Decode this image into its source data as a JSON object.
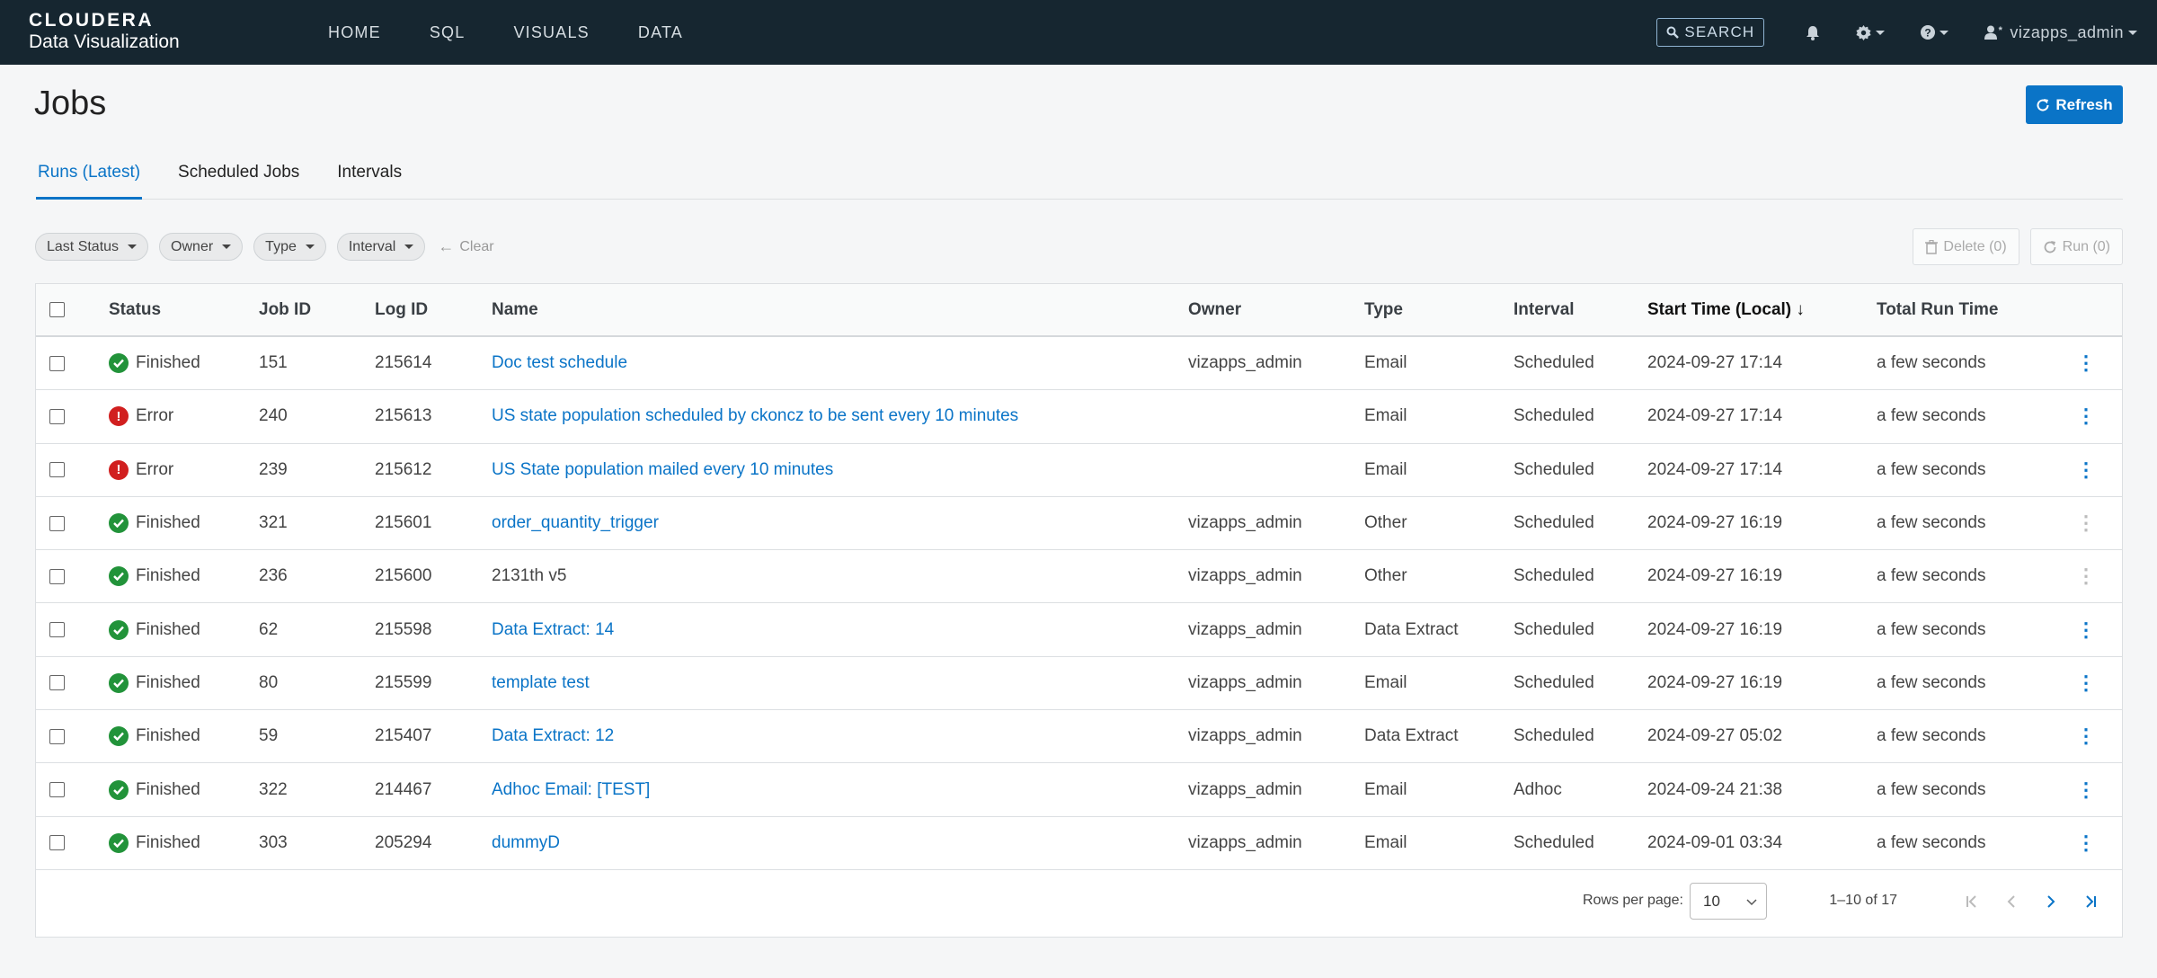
{
  "brand": {
    "top": "CLOUDERA",
    "bottom": "Data Visualization"
  },
  "nav": {
    "links": [
      "HOME",
      "SQL",
      "VISUALS",
      "DATA"
    ],
    "search_label": "SEARCH",
    "user_name": "vizapps_admin"
  },
  "page": {
    "title": "Jobs",
    "refresh_label": "Refresh"
  },
  "tabs": [
    {
      "label": "Runs (Latest)",
      "active": true
    },
    {
      "label": "Scheduled Jobs",
      "active": false
    },
    {
      "label": "Intervals",
      "active": false
    }
  ],
  "filters": {
    "chips": [
      "Last Status",
      "Owner",
      "Type",
      "Interval"
    ],
    "clear_label": "Clear",
    "delete_label": "Delete (0)",
    "run_label": "Run (0)"
  },
  "table": {
    "headers": {
      "status": "Status",
      "job_id": "Job ID",
      "log_id": "Log ID",
      "name": "Name",
      "owner": "Owner",
      "type": "Type",
      "interval": "Interval",
      "start_time": "Start Time (Local) ↓",
      "run_time": "Total Run Time"
    },
    "rows": [
      {
        "status": "Finished",
        "job_id": "151",
        "log_id": "215614",
        "name": "Doc test schedule",
        "owner": "vizapps_admin",
        "type": "Email",
        "interval": "Scheduled",
        "start_time": "2024-09-27 17:14",
        "run_time": "a few seconds"
      },
      {
        "status": "Error",
        "job_id": "240",
        "log_id": "215613",
        "name": "US state population scheduled by ckoncz to be sent every 10 minutes",
        "owner": "",
        "type": "Email",
        "interval": "Scheduled",
        "start_time": "2024-09-27 17:14",
        "run_time": "a few seconds"
      },
      {
        "status": "Error",
        "job_id": "239",
        "log_id": "215612",
        "name": "US State population mailed every 10 minutes",
        "owner": "",
        "type": "Email",
        "interval": "Scheduled",
        "start_time": "2024-09-27 17:14",
        "run_time": "a few seconds"
      },
      {
        "status": "Finished",
        "job_id": "321",
        "log_id": "215601",
        "name": "order_quantity_trigger",
        "owner": "vizapps_admin",
        "type": "Other",
        "interval": "Scheduled",
        "start_time": "2024-09-27 16:19",
        "run_time": "a few seconds"
      },
      {
        "status": "Finished",
        "job_id": "236",
        "log_id": "215600",
        "name": "2131th v5",
        "owner": "vizapps_admin",
        "type": "Other",
        "interval": "Scheduled",
        "start_time": "2024-09-27 16:19",
        "run_time": "a few seconds"
      },
      {
        "status": "Finished",
        "job_id": "62",
        "log_id": "215598",
        "name": "Data Extract: 14",
        "owner": "vizapps_admin",
        "type": "Data Extract",
        "interval": "Scheduled",
        "start_time": "2024-09-27 16:19",
        "run_time": "a few seconds"
      },
      {
        "status": "Finished",
        "job_id": "80",
        "log_id": "215599",
        "name": "template test",
        "owner": "vizapps_admin",
        "type": "Email",
        "interval": "Scheduled",
        "start_time": "2024-09-27 16:19",
        "run_time": "a few seconds"
      },
      {
        "status": "Finished",
        "job_id": "59",
        "log_id": "215407",
        "name": "Data Extract: 12",
        "owner": "vizapps_admin",
        "type": "Data Extract",
        "interval": "Scheduled",
        "start_time": "2024-09-27 05:02",
        "run_time": "a few seconds"
      },
      {
        "status": "Finished",
        "job_id": "322",
        "log_id": "214467",
        "name": "Adhoc Email: [TEST]",
        "owner": "vizapps_admin",
        "type": "Email",
        "interval": "Adhoc",
        "start_time": "2024-09-24 21:38",
        "run_time": "a few seconds"
      },
      {
        "status": "Finished",
        "job_id": "303",
        "log_id": "205294",
        "name": "dummyD",
        "owner": "vizapps_admin",
        "type": "Email",
        "interval": "Scheduled",
        "start_time": "2024-09-01 03:34",
        "run_time": "a few seconds"
      }
    ]
  },
  "pagination": {
    "rows_per_page_label": "Rows per page:",
    "rows_per_page_value": "10",
    "range": "1–10 of 17"
  },
  "colors": {
    "nav_bg": "#162630",
    "accent": "#0a74c7",
    "success": "#22933a",
    "error": "#d11f1f"
  },
  "icons": [
    "search-icon",
    "bell-icon",
    "gear-icon",
    "help-icon",
    "user-icon",
    "refresh-icon",
    "trash-icon",
    "rerun-icon",
    "kebab-icon",
    "first-page-icon",
    "prev-page-icon",
    "next-page-icon",
    "last-page-icon"
  ]
}
